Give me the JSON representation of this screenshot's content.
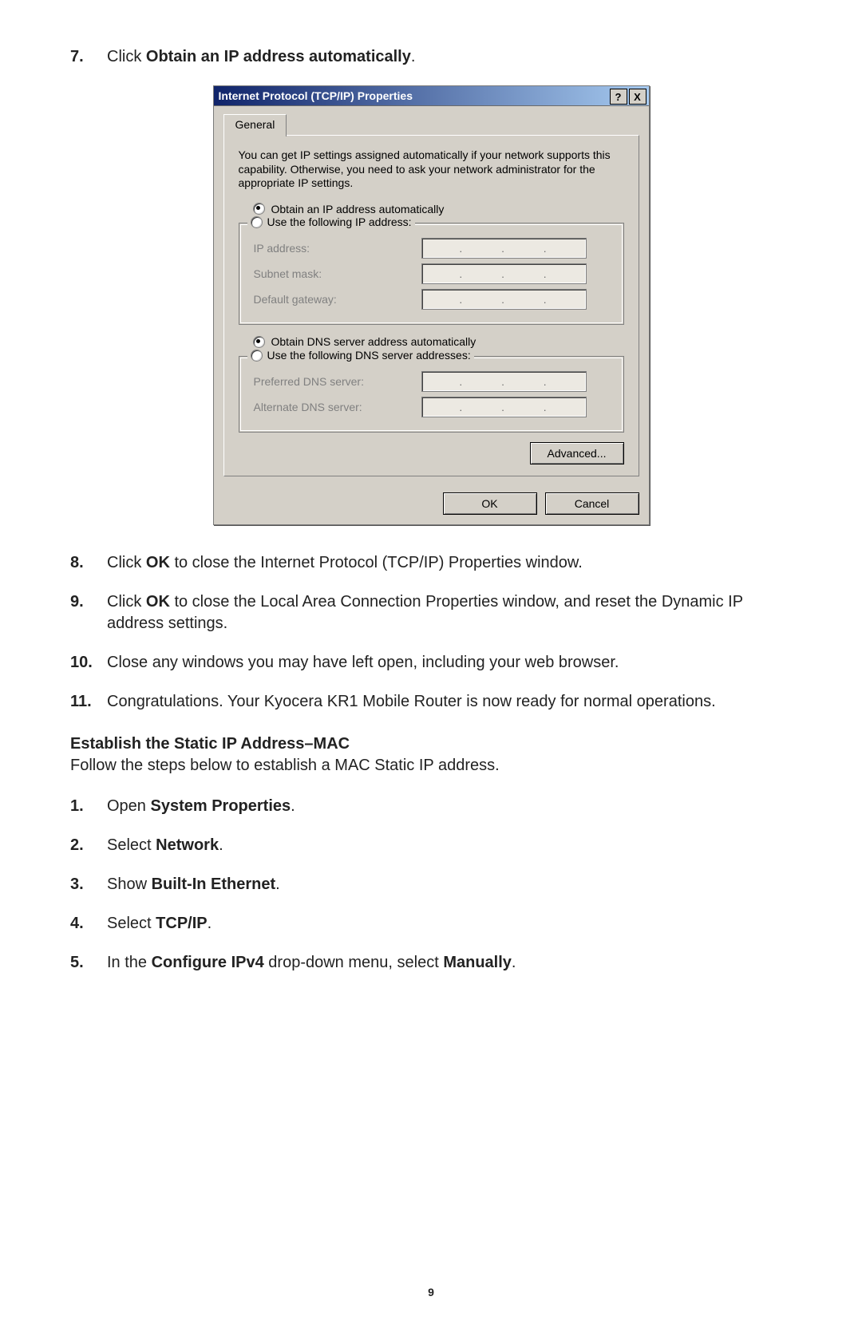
{
  "steps_top": [
    {
      "num": "7.",
      "lead": "Click ",
      "bold": "Obtain an IP address automatically",
      "tail": "."
    }
  ],
  "dialog": {
    "title": "Internet Protocol (TCP/IP) Properties",
    "help_btn": "?",
    "close_btn": "X",
    "tab": "General",
    "desc": "You can get IP settings assigned automatically if your network supports this capability. Otherwise, you need to ask your network administrator for the appropriate IP settings.",
    "radio_ip_auto": "Obtain an IP address automatically",
    "radio_ip_manual": "Use the following IP address:",
    "fields_ip": [
      {
        "label": "IP address:"
      },
      {
        "label": "Subnet mask:"
      },
      {
        "label": "Default gateway:"
      }
    ],
    "radio_dns_auto": "Obtain DNS server address automatically",
    "radio_dns_manual": "Use the following DNS server addresses:",
    "fields_dns": [
      {
        "label": "Preferred DNS server:"
      },
      {
        "label": "Alternate DNS server:"
      }
    ],
    "advanced": "Advanced...",
    "ok": "OK",
    "cancel": "Cancel"
  },
  "steps_mid": [
    {
      "num": "8.",
      "parts": [
        {
          "t": "Click "
        },
        {
          "b": "OK"
        },
        {
          "t": " to close the Internet Protocol (TCP/IP) Properties window."
        }
      ]
    },
    {
      "num": "9.",
      "parts": [
        {
          "t": "Click "
        },
        {
          "b": "OK"
        },
        {
          "t": " to close the Local Area Connection Properties window, and reset the Dynamic IP address settings."
        }
      ]
    },
    {
      "num": "10.",
      "parts": [
        {
          "t": "Close any windows you may have left open, including your web browser."
        }
      ]
    },
    {
      "num": "11.",
      "parts": [
        {
          "t": "Congratulations. Your Kyocera KR1 Mobile Router is now ready for normal operations."
        }
      ]
    }
  ],
  "section": {
    "head": "Establish the Static IP Address–MAC",
    "sub": "Follow the steps below to establish a MAC Static IP address."
  },
  "steps_mac": [
    {
      "num": "1.",
      "parts": [
        {
          "t": "Open "
        },
        {
          "b": "System Properties"
        },
        {
          "t": "."
        }
      ]
    },
    {
      "num": "2.",
      "parts": [
        {
          "t": "Select "
        },
        {
          "b": "Network"
        },
        {
          "t": "."
        }
      ]
    },
    {
      "num": "3.",
      "parts": [
        {
          "t": "Show "
        },
        {
          "b": "Built-In Ethernet"
        },
        {
          "t": "."
        }
      ]
    },
    {
      "num": "4.",
      "parts": [
        {
          "t": "Select "
        },
        {
          "b": "TCP/IP"
        },
        {
          "t": "."
        }
      ]
    },
    {
      "num": "5.",
      "parts": [
        {
          "t": "In the "
        },
        {
          "b": "Configure IPv4"
        },
        {
          "t": " drop-down menu, select "
        },
        {
          "b": "Manually"
        },
        {
          "t": "."
        }
      ]
    }
  ],
  "page_number": "9"
}
